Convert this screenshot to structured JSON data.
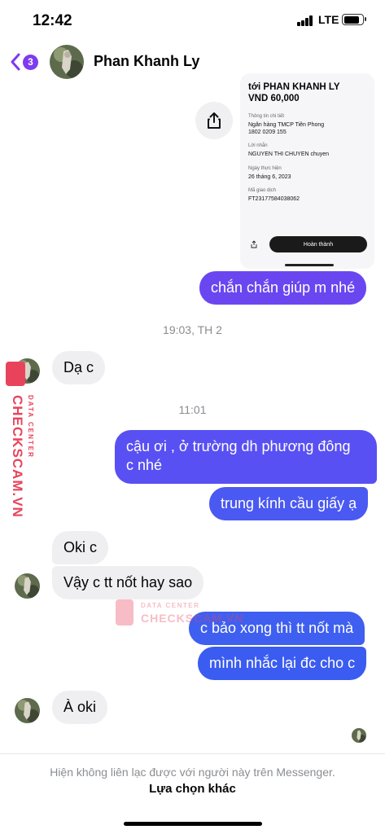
{
  "status_bar": {
    "time": "12:42",
    "network": "LTE"
  },
  "header": {
    "back_count": "3",
    "contact_name": "Phan Khanh Ly"
  },
  "receipt_image": {
    "title_line1": "tới PHAN KHANH LY",
    "title_line2": "VND 60,000",
    "details_label": "Thông tin chi tiết",
    "bank": "Ngân hàng TMCP Tiên Phong",
    "account": "1802 0209 155",
    "message_label": "Lời nhắn",
    "message": "NGUYEN THI CHUYEN chuyen",
    "date_label": "Ngày thực hiện",
    "date": "26 tháng 6, 2023",
    "txn_label": "Mã giao dịch",
    "txn": "FT23177584038062",
    "done_button": "Hoàn thành"
  },
  "messages": {
    "out_1": "chắn chắn giúp m nhé",
    "stamp_1": "19:03, TH 2",
    "in_1": "Dạ c",
    "stamp_2": "11:01",
    "out_2_line1": "cậu ơi , ở trường dh phương đông",
    "out_2_line2": "c nhé",
    "out_3": "trung kính cầu giấy ạ",
    "in_2": "Oki c",
    "in_3": "Vậy c tt nốt hay sao",
    "out_4": "c bảo xong thì tt nốt mà",
    "out_5": "mình nhắc lại đc cho c",
    "in_4": "À oki"
  },
  "watermark": {
    "main": "CHECKSCAM.VN",
    "sub": "DATA CENTER"
  },
  "footer": {
    "info": "Hiện không liên lạc được với người này trên Messenger.",
    "link": "Lựa chọn khác"
  },
  "colors": {
    "accent": "#7d3bf0",
    "bubble_in": "#efeff1",
    "gradient_top": "#7b3ff2",
    "gradient_bottom": "#3b5cf0"
  }
}
